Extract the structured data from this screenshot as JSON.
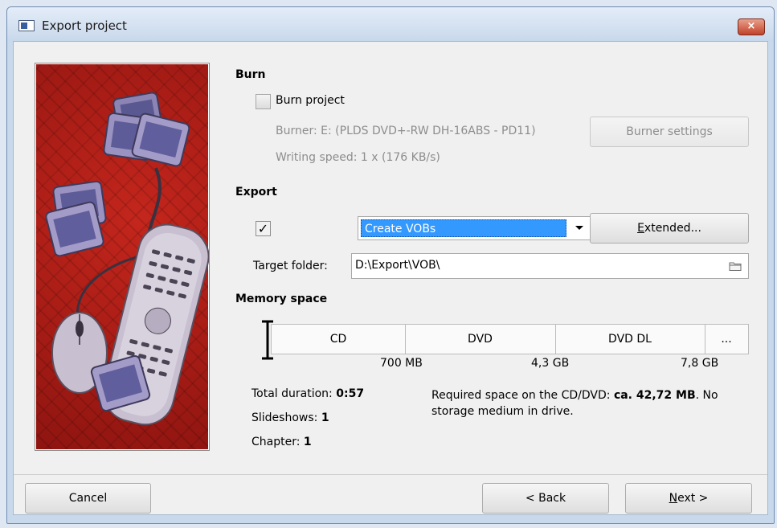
{
  "window": {
    "title": "Export project",
    "close_label": "×"
  },
  "burn": {
    "heading": "Burn",
    "burn_project_label": "Burn project",
    "burn_project_checked": false,
    "burner_text": "Burner: E: (PLDS DVD+-RW DH-16ABS - PD11)",
    "writing_speed_text": "Writing speed: 1 x (176 KB/s)",
    "burner_settings_label": "Burner settings"
  },
  "export": {
    "heading": "Export",
    "enabled_mark": "✓",
    "enabled_checked": true,
    "format_selected": "Create VOBs",
    "extended_prefix": "E",
    "extended_rest": "xtended...",
    "target_folder_label": "Target folder:",
    "target_folder_value": "D:\\Export\\VOB\\"
  },
  "memory": {
    "heading": "Memory space",
    "media": [
      "CD",
      "DVD",
      "DVD DL",
      "..."
    ],
    "capacities": [
      "700 MB",
      "4,3 GB",
      "7,8 GB"
    ]
  },
  "stats": {
    "total_duration_label": "Total duration: ",
    "total_duration_value": "0:57",
    "slideshows_label": "Slideshows: ",
    "slideshows_value": "1",
    "chapter_label": "Chapter: ",
    "chapter_value": "1",
    "required_space_prefix": "Required space on the CD/DVD: ",
    "required_space_value": "ca. 42,72 MB",
    "required_space_suffix": ". No",
    "required_space_line2": "storage medium in drive."
  },
  "footer": {
    "cancel_label": "Cancel",
    "back_label": "< Back",
    "next_prefix": "N",
    "next_rest": "ext >"
  },
  "colors": {
    "selection": "#3399ff",
    "image_red": "#b0201a"
  }
}
